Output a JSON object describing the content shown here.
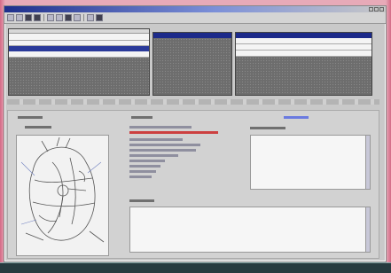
{
  "window": {
    "title": ""
  },
  "toolbar": {
    "buttons": [
      "tool-1",
      "tool-2",
      "tool-3",
      "tool-4",
      "tool-5",
      "tool-6",
      "tool-7",
      "tool-8",
      "tool-9",
      "tool-10",
      "tool-11",
      "tool-12"
    ]
  },
  "panes": [
    {
      "name": "left-list"
    },
    {
      "name": "middle-list"
    },
    {
      "name": "right-list"
    }
  ],
  "colors": {
    "titlebar": "#1e2f8c",
    "selection": "#2a3a9a",
    "pane_bg": "#6d6d6d",
    "accent_red": "#cc4040",
    "link_blue": "#6a7ae0",
    "desktop": "#e7aab8"
  },
  "illustration": {
    "icon": "anatomy-heart-drawing"
  }
}
